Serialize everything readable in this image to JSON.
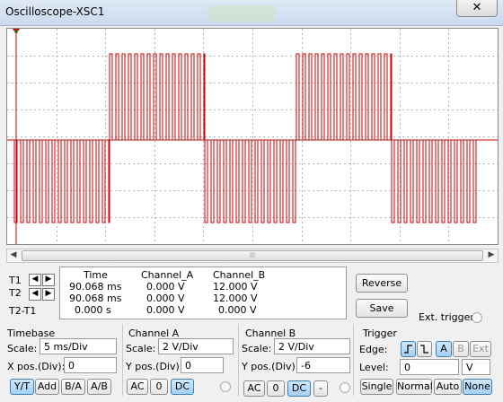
{
  "window": {
    "title": "Oscilloscope-XSC1",
    "close_glyph": "✕"
  },
  "screen": {
    "channel_color": "#cc0000",
    "grid_color": "#b5b5b5",
    "trace": {
      "type": "line",
      "samples": 600
    }
  },
  "cursors": {
    "t1_label": "T1",
    "t2_label": "T2",
    "t2t1_label": "T2-T1",
    "left_arrow": "◀",
    "right_arrow": "▶"
  },
  "readout": {
    "headers": [
      "Time",
      "Channel_A",
      "Channel_B"
    ],
    "rows": [
      [
        "90.068 ms",
        "0.000 V",
        "12.000 V"
      ],
      [
        "90.068 ms",
        "0.000 V",
        "12.000 V"
      ],
      [
        "0.000 s",
        "0.000 V",
        "0.000 V"
      ]
    ]
  },
  "buttons": {
    "reverse": "Reverse",
    "save": "Save",
    "ext_trigger": "Ext. trigger"
  },
  "timebase": {
    "title": "Timebase",
    "scale_label": "Scale:",
    "scale_value": "5 ms/Div",
    "xpos_label": "X pos.(Div):",
    "xpos_value": "0",
    "modes": [
      "Y/T",
      "Add",
      "B/A",
      "A/B"
    ]
  },
  "channel_a": {
    "title": "Channel A",
    "scale_label": "Scale:",
    "scale_value": "2  V/Div",
    "ypos_label": "Y pos.(Div):",
    "ypos_value": "0",
    "coupling": [
      "AC",
      "0",
      "DC"
    ]
  },
  "channel_b": {
    "title": "Channel B",
    "scale_label": "Scale:",
    "scale_value": "2  V/Div",
    "ypos_label": "Y pos.(Div):",
    "ypos_value": "-6",
    "coupling": [
      "AC",
      "0",
      "DC",
      "-"
    ]
  },
  "trigger": {
    "title": "Trigger",
    "edge_label": "Edge:",
    "edge_buttons": [
      "A",
      "B",
      "Ext"
    ],
    "level_label": "Level:",
    "level_value": "0",
    "level_unit": "V",
    "modes": [
      "Single",
      "Normal",
      "Auto",
      "None"
    ]
  },
  "hscroll": {
    "left": "◀",
    "right": "▶",
    "grip": "|||"
  }
}
